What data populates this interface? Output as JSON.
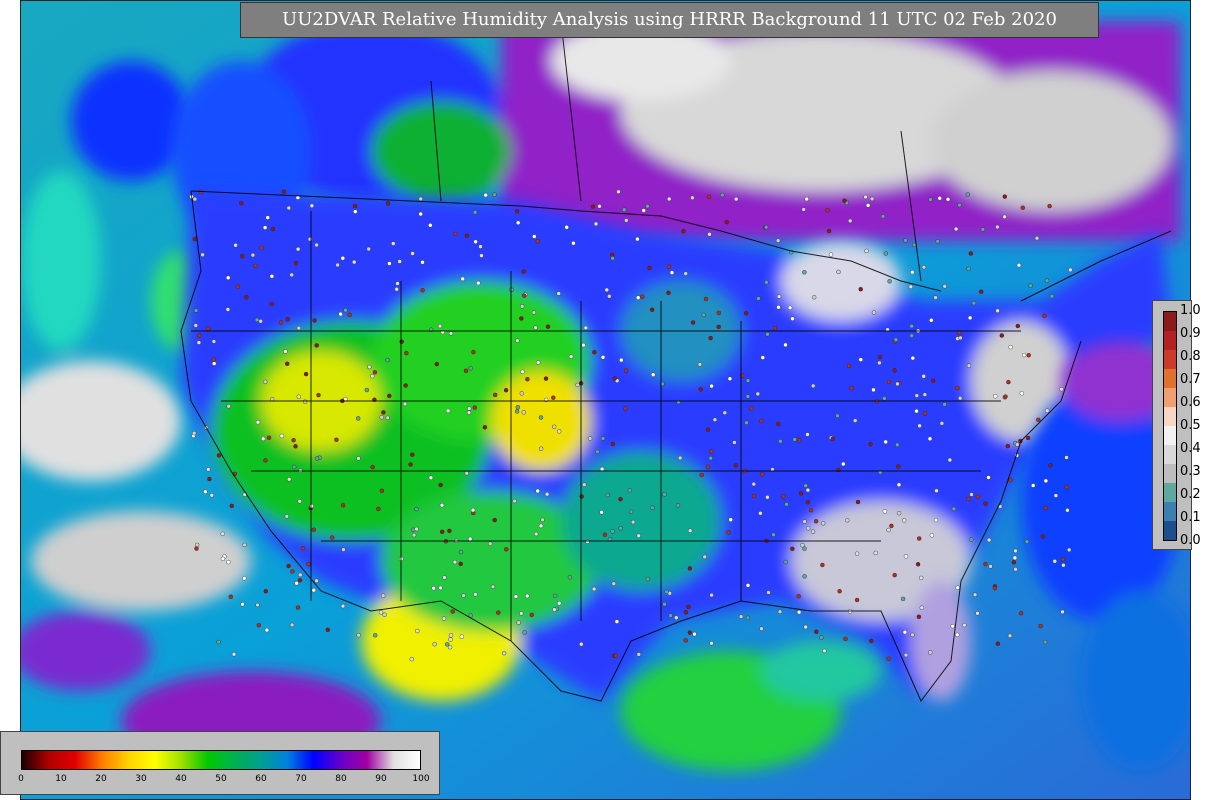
{
  "title": "UU2DVAR Relative Humidity Analysis using HRRR Background 11 UTC 02 Feb 2020",
  "obs_colorbar": {
    "ticks": [
      "1.0",
      "0.9",
      "0.8",
      "0.7",
      "0.6",
      "0.5",
      "0.4",
      "0.3",
      "0.2",
      "0.1",
      "0.0"
    ],
    "colors": [
      "#8b1a1a",
      "#b22222",
      "#cd3a2a",
      "#e07030",
      "#f0a070",
      "#f7d7c4",
      "#f2f2f2",
      "#d9d9d9",
      "#bdbdbd",
      "#5fa8a0",
      "#3d7fb0",
      "#1f4e8f"
    ]
  },
  "rh_colorbar": {
    "ticks": [
      "0",
      "10",
      "20",
      "30",
      "40",
      "50",
      "60",
      "70",
      "80",
      "90",
      "100"
    ],
    "colors": [
      "#1a0000",
      "#b00000",
      "#e00000",
      "#ff7b00",
      "#ffd200",
      "#ffff00",
      "#a0e000",
      "#00c800",
      "#00b050",
      "#00a090",
      "#0080e0",
      "#0000ff",
      "#6600cc",
      "#a000a0",
      "#e0e0e0",
      "#ffffff"
    ]
  },
  "colors": {
    "ocean_cyan": "#1fb8c8",
    "dry_yellow": "#e8e800",
    "moist_blue": "#1a2cff",
    "saturated_purple": "#8a1ac0",
    "near_saturation_gray": "#d0d0d0"
  }
}
